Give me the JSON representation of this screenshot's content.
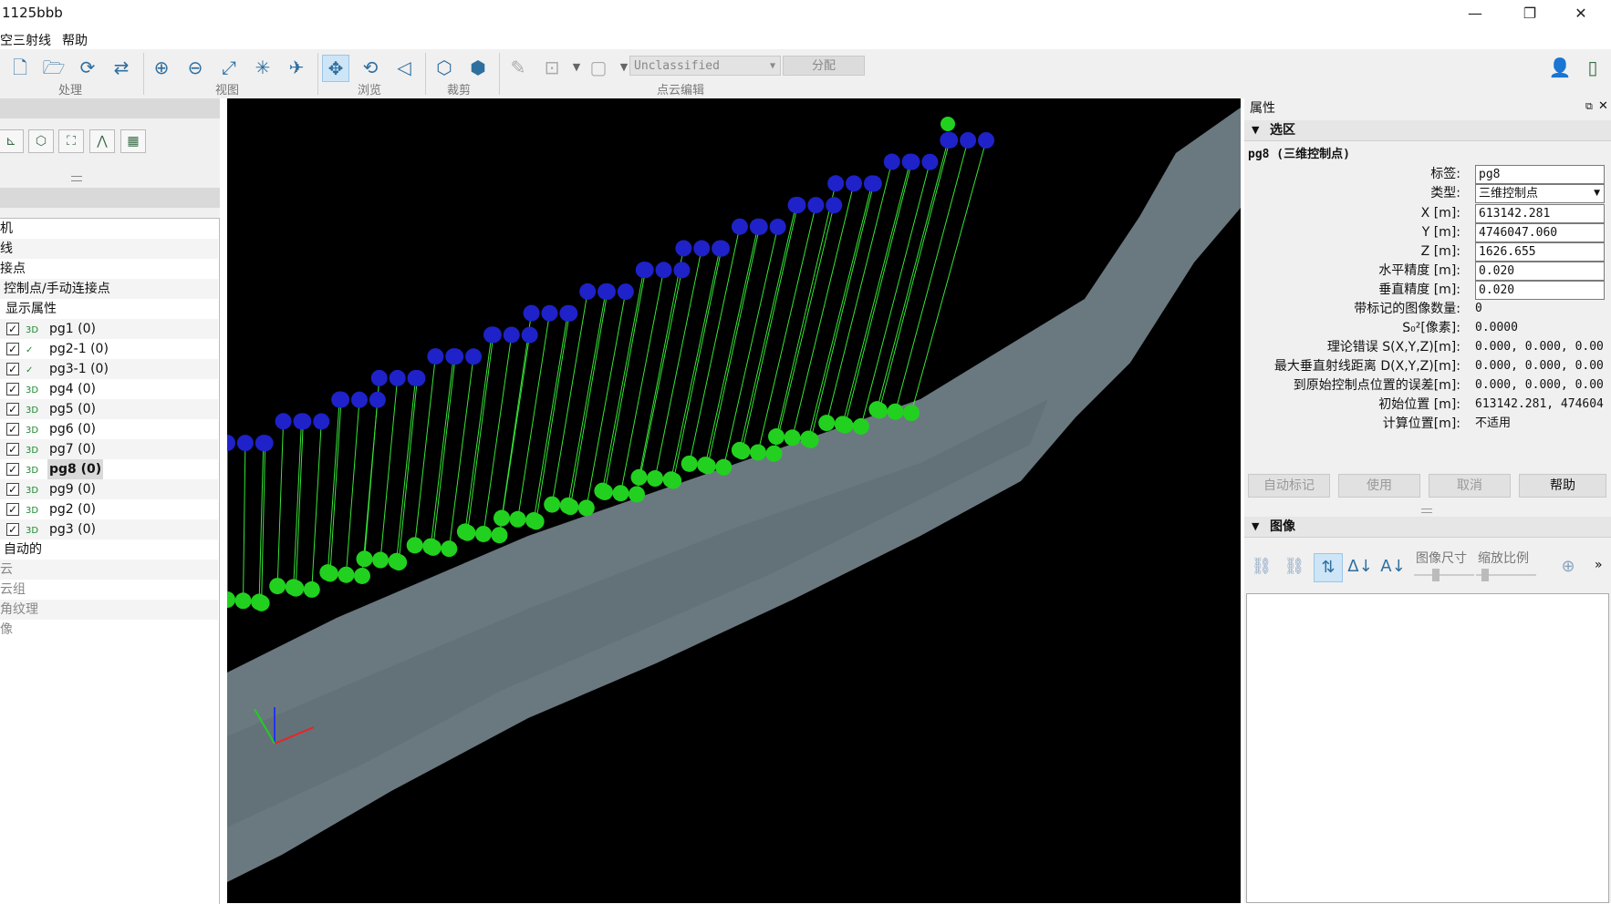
{
  "window": {
    "title": "1125bbb",
    "controls": [
      "—",
      "❐",
      "✕"
    ]
  },
  "menu": [
    "空三射线",
    "帮助"
  ],
  "toolbar": {
    "groups": [
      "处理",
      "视图",
      "浏览",
      "裁剪",
      "点云编辑"
    ],
    "class_combo": "Unclassified",
    "assign_button": "分配"
  },
  "tree": {
    "rows": [
      "机",
      "线",
      "接点",
      "控制点/手动连接点",
      "显示属性",
      "pg1 (0)",
      "pg2-1 (0)",
      "pg3-1 (0)",
      "pg4 (0)",
      "pg5 (0)",
      "pg6 (0)",
      "pg7 (0)",
      "pg8 (0)",
      "pg9 (0)",
      "pg2 (0)",
      "pg3 (0)",
      "自动的",
      "云",
      "云组",
      "角纹理",
      "像"
    ],
    "icon_3d": "3D"
  },
  "properties": {
    "panel_title": "属性",
    "section_selection": "选区",
    "point_name": "pg8 (三维控制点)",
    "fields": {
      "label_key": "标签:",
      "label_value": "pg8",
      "type_key": "类型:",
      "type_value": "三维控制点",
      "x_key": "X [m]:",
      "x_value": "613142.281",
      "y_key": "Y [m]:",
      "y_value": "4746047.060",
      "z_key": "Z [m]:",
      "z_value": "1626.655",
      "hacc_key": "水平精度 [m]:",
      "hacc_value": "0.020",
      "vacc_key": "垂直精度 [m]:",
      "vacc_value": "0.020",
      "marked_key": "带标记的图像数量:",
      "marked_value": "0",
      "s0_key": "S₀²[像素]:",
      "s0_value": "0.0000",
      "theory_key": "理论错误 S(X,Y,Z)[m]:",
      "theory_value": "0.000, 0.000, 0.00",
      "maxdist_key": "最大垂直射线距离 D(X,Y,Z)[m]:",
      "maxdist_value": "0.000, 0.000, 0.00",
      "orig_err_key": "到原始控制点位置的误差[m]:",
      "orig_err_value": "0.000, 0.000, 0.00",
      "init_pos_key": "初始位置 [m]:",
      "init_pos_value": "613142.281, 474604",
      "calc_pos_key": "计算位置[m]:",
      "calc_pos_value": "不适用"
    },
    "buttons": [
      "自动标记",
      "使用",
      "取消",
      "帮助"
    ],
    "section_images": "图像",
    "image_size_label": "图像尺寸",
    "zoom_label": "缩放比例"
  },
  "colors": {
    "viewport_bg": "#000000",
    "gcp_blue": "#1f22c8",
    "gcp_green": "#22d11f",
    "ray_green": "#3cff3c",
    "terrain": "#8fa0a8"
  }
}
